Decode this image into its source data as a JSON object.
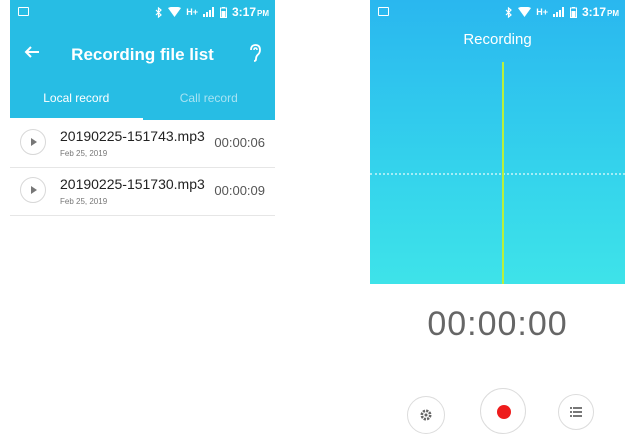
{
  "status_bar": {
    "time": "3:17",
    "ampm": "PM",
    "network": "H+"
  },
  "file_list_screen": {
    "title": "Recording file list",
    "tabs": [
      {
        "label": "Local record",
        "active": true
      },
      {
        "label": "Call record",
        "active": false
      }
    ],
    "recordings": [
      {
        "name": "20190225-151743.mp3",
        "date": "Feb 25, 2019",
        "duration": "00:00:06"
      },
      {
        "name": "20190225-151730.mp3",
        "date": "Feb 25, 2019",
        "duration": "00:00:09"
      }
    ]
  },
  "recording_screen": {
    "title": "Recording",
    "timer": "00:00:00"
  },
  "colors": {
    "app_bar": "#27bde4",
    "record_dot": "#ee1c1c",
    "playhead": "#b8f03c"
  }
}
